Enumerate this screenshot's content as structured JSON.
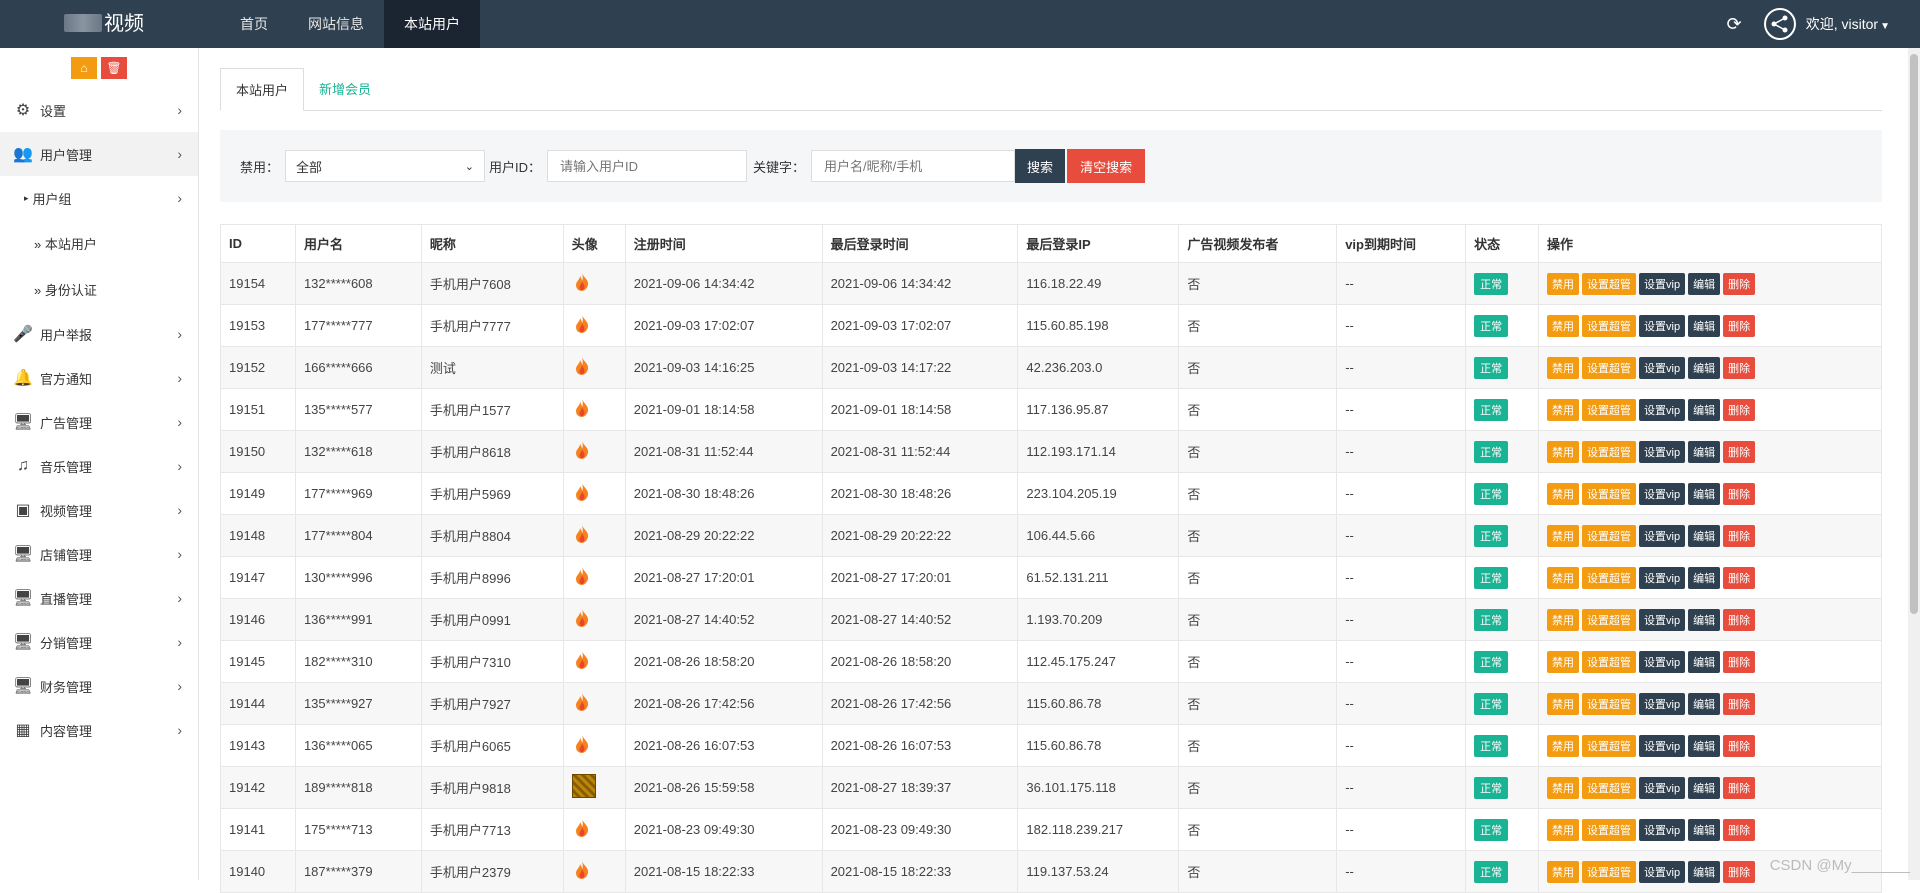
{
  "header": {
    "logo_text": "视频",
    "nav": [
      {
        "label": "首页"
      },
      {
        "label": "网站信息"
      },
      {
        "label": "本站用户"
      }
    ],
    "welcome_text": "欢迎, visitor"
  },
  "sidebar": {
    "items": [
      {
        "label": "设置",
        "icon": "gears-icon"
      },
      {
        "label": "用户管理",
        "icon": "users-icon"
      },
      {
        "label": "用户组",
        "icon": "caret-right-icon"
      },
      {
        "label": "» 本站用户"
      },
      {
        "label": "» 身份认证"
      },
      {
        "label": "用户举报",
        "icon": "microphone-icon"
      },
      {
        "label": "官方通知",
        "icon": "bell-icon"
      },
      {
        "label": "广告管理",
        "icon": "monitor-icon"
      },
      {
        "label": "音乐管理",
        "icon": "music-icon"
      },
      {
        "label": "视频管理",
        "icon": "video-file-icon"
      },
      {
        "label": "店铺管理",
        "icon": "monitor-icon"
      },
      {
        "label": "直播管理",
        "icon": "monitor-icon"
      },
      {
        "label": "分销管理",
        "icon": "monitor-icon"
      },
      {
        "label": "财务管理",
        "icon": "monitor-icon"
      },
      {
        "label": "内容管理",
        "icon": "grid-icon"
      }
    ]
  },
  "tabs": [
    {
      "label": "本站用户"
    },
    {
      "label": "新增会员"
    }
  ],
  "filters": {
    "ban_label": "禁用：",
    "ban_value": "全部",
    "uid_label": "用户ID：",
    "uid_placeholder": "请输入用户ID",
    "kw_label": "关键字：",
    "kw_placeholder": "用户名/昵称/手机",
    "search_label": "搜索",
    "clear_label": "清空搜索"
  },
  "table": {
    "headers": [
      "ID",
      "用户名",
      "昵称",
      "头像",
      "注册时间",
      "最后登录时间",
      "最后登录IP",
      "广告视频发布者",
      "vip到期时间",
      "状态",
      "操作"
    ],
    "rows": [
      {
        "id": "19154",
        "username": "132*****608",
        "nickname": "手机用户7608",
        "reg": "2021-09-06 14:34:42",
        "last": "2021-09-06 14:34:42",
        "ip": "116.18.22.49",
        "ad": "否",
        "vip": "--",
        "status": "正常"
      },
      {
        "id": "19153",
        "username": "177*****777",
        "nickname": "手机用户7777",
        "reg": "2021-09-03 17:02:07",
        "last": "2021-09-03 17:02:07",
        "ip": "115.60.85.198",
        "ad": "否",
        "vip": "--",
        "status": "正常"
      },
      {
        "id": "19152",
        "username": "166*****666",
        "nickname": "测试",
        "reg": "2021-09-03 14:16:25",
        "last": "2021-09-03 14:17:22",
        "ip": "42.236.203.0",
        "ad": "否",
        "vip": "--",
        "status": "正常"
      },
      {
        "id": "19151",
        "username": "135*****577",
        "nickname": "手机用户1577",
        "reg": "2021-09-01 18:14:58",
        "last": "2021-09-01 18:14:58",
        "ip": "117.136.95.87",
        "ad": "否",
        "vip": "--",
        "status": "正常"
      },
      {
        "id": "19150",
        "username": "132*****618",
        "nickname": "手机用户8618",
        "reg": "2021-08-31 11:52:44",
        "last": "2021-08-31 11:52:44",
        "ip": "112.193.171.14",
        "ad": "否",
        "vip": "--",
        "status": "正常"
      },
      {
        "id": "19149",
        "username": "177*****969",
        "nickname": "手机用户5969",
        "reg": "2021-08-30 18:48:26",
        "last": "2021-08-30 18:48:26",
        "ip": "223.104.205.19",
        "ad": "否",
        "vip": "--",
        "status": "正常"
      },
      {
        "id": "19148",
        "username": "177*****804",
        "nickname": "手机用户8804",
        "reg": "2021-08-29 20:22:22",
        "last": "2021-08-29 20:22:22",
        "ip": "106.44.5.66",
        "ad": "否",
        "vip": "--",
        "status": "正常"
      },
      {
        "id": "19147",
        "username": "130*****996",
        "nickname": "手机用户8996",
        "reg": "2021-08-27 17:20:01",
        "last": "2021-08-27 17:20:01",
        "ip": "61.52.131.211",
        "ad": "否",
        "vip": "--",
        "status": "正常"
      },
      {
        "id": "19146",
        "username": "136*****991",
        "nickname": "手机用户0991",
        "reg": "2021-08-27 14:40:52",
        "last": "2021-08-27 14:40:52",
        "ip": "1.193.70.209",
        "ad": "否",
        "vip": "--",
        "status": "正常"
      },
      {
        "id": "19145",
        "username": "182*****310",
        "nickname": "手机用户7310",
        "reg": "2021-08-26 18:58:20",
        "last": "2021-08-26 18:58:20",
        "ip": "112.45.175.247",
        "ad": "否",
        "vip": "--",
        "status": "正常"
      },
      {
        "id": "19144",
        "username": "135*****927",
        "nickname": "手机用户7927",
        "reg": "2021-08-26 17:42:56",
        "last": "2021-08-26 17:42:56",
        "ip": "115.60.86.78",
        "ad": "否",
        "vip": "--",
        "status": "正常"
      },
      {
        "id": "19143",
        "username": "136*****065",
        "nickname": "手机用户6065",
        "reg": "2021-08-26 16:07:53",
        "last": "2021-08-26 16:07:53",
        "ip": "115.60.86.78",
        "ad": "否",
        "vip": "--",
        "status": "正常"
      },
      {
        "id": "19142",
        "username": "189*****818",
        "nickname": "手机用户9818",
        "reg": "2021-08-26 15:59:58",
        "last": "2021-08-27 18:39:37",
        "ip": "36.101.175.118",
        "ad": "否",
        "vip": "--",
        "status": "正常",
        "custom_avatar": true
      },
      {
        "id": "19141",
        "username": "175*****713",
        "nickname": "手机用户7713",
        "reg": "2021-08-23 09:49:30",
        "last": "2021-08-23 09:49:30",
        "ip": "182.118.239.217",
        "ad": "否",
        "vip": "--",
        "status": "正常"
      },
      {
        "id": "19140",
        "username": "187*****379",
        "nickname": "手机用户2379",
        "reg": "2021-08-15 18:22:33",
        "last": "2021-08-15 18:22:33",
        "ip": "119.137.53.24",
        "ad": "否",
        "vip": "--",
        "status": "正常"
      }
    ],
    "ops": {
      "ban": "禁用",
      "admin": "设置超管",
      "vip": "设置vip",
      "edit": "编辑",
      "del": "删除"
    }
  },
  "watermark": "CSDN @My_______",
  "colors": {
    "topbar": "#2f4050",
    "accent": "#1ab394",
    "warn": "#f39c12",
    "danger": "#e74c3c"
  }
}
